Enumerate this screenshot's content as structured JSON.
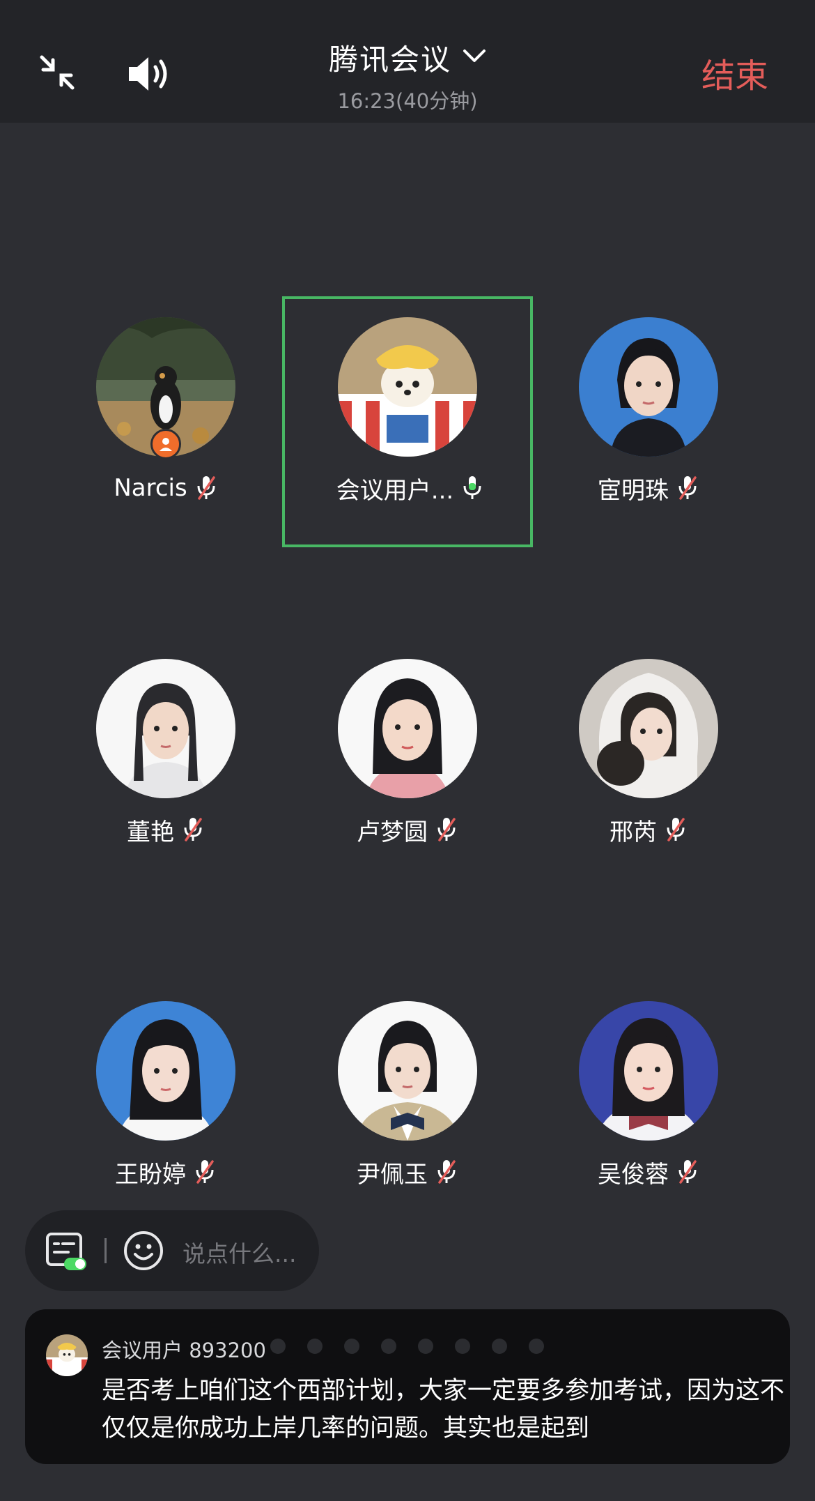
{
  "header": {
    "title": "腾讯会议",
    "subtitle": "16:23(40分钟)",
    "end_label": "结束",
    "end_color": "#e45d5a"
  },
  "participants": [
    {
      "name": "Narcis",
      "mic": "muted",
      "host": true,
      "avatar": "cat-photo"
    },
    {
      "name": "会议用户...",
      "mic": "active",
      "speaking": true,
      "avatar": "dog-photo"
    },
    {
      "name": "宦明珠",
      "mic": "muted",
      "avatar": "portrait-blue"
    },
    {
      "name": "董艳",
      "mic": "muted",
      "avatar": "portrait-white"
    },
    {
      "name": "卢梦圆",
      "mic": "muted",
      "avatar": "portrait-white"
    },
    {
      "name": "邢芮",
      "mic": "muted",
      "avatar": "portrait-hood"
    },
    {
      "name": "王盼婷",
      "mic": "muted",
      "avatar": "portrait-blue"
    },
    {
      "name": "尹佩玉",
      "mic": "muted",
      "avatar": "portrait-white"
    },
    {
      "name": "吴俊蓉",
      "mic": "muted",
      "avatar": "portrait-navy"
    }
  ],
  "input": {
    "placeholder": "说点什么..."
  },
  "chat": {
    "user": "会议用户 893200",
    "message": "是否考上咱们这个西部计划，大家一定要多参加考试，因为这不仅仅是你成功上岸几率的问题。其实也是起到"
  },
  "colors": {
    "speaking_border": "#48b764",
    "active_mic": "#4cd964",
    "muted_mic_slash": "#e45d5a"
  }
}
